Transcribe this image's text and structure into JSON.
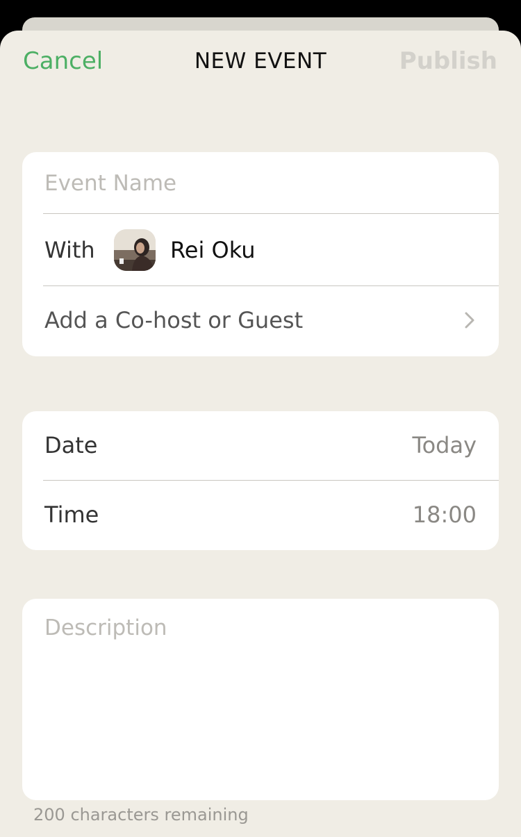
{
  "nav": {
    "cancel_label": "Cancel",
    "title": "NEW EVENT",
    "publish_label": "Publish"
  },
  "event": {
    "name_placeholder": "Event Name",
    "name_value": "",
    "with_label": "With",
    "host_name": "Rei Oku",
    "add_guest_label": "Add a Co-host or Guest"
  },
  "schedule": {
    "date_label": "Date",
    "date_value": "Today",
    "time_label": "Time",
    "time_value": "18:00"
  },
  "description": {
    "placeholder": "Description",
    "value": "",
    "counter_text": "200 characters remaining"
  },
  "icons": {
    "chevron": "chevron-right-icon",
    "avatar": "user-avatar"
  },
  "colors": {
    "accent": "#4caf64",
    "background": "#f0ede5",
    "disabled": "#d3d1cb"
  }
}
